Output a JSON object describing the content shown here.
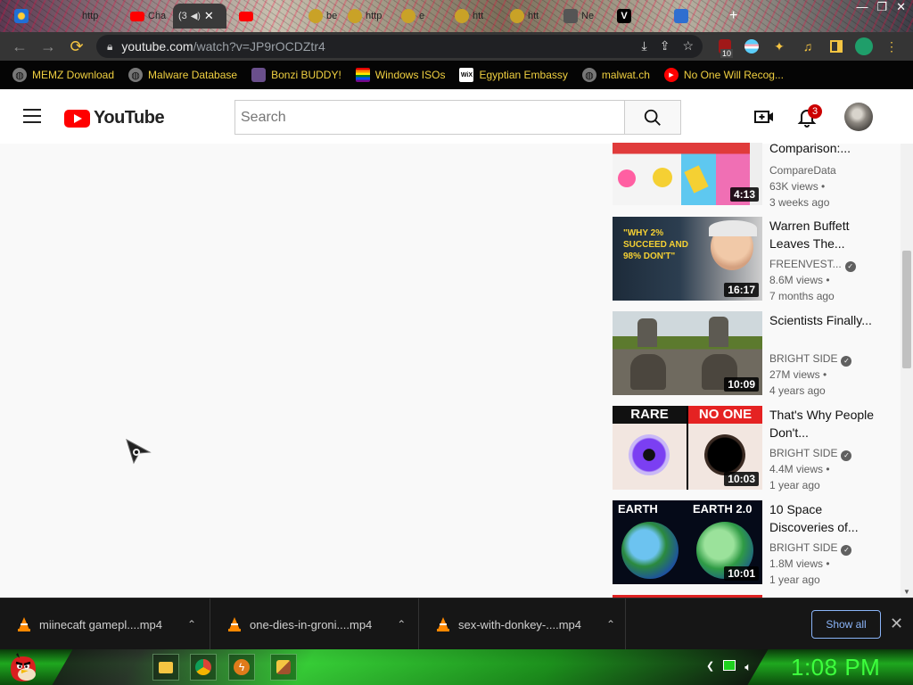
{
  "browser": {
    "tabs": [
      {
        "label": "http",
        "icon": "firefox-icon"
      },
      {
        "label": "Cha",
        "icon": "youtube-icon"
      },
      {
        "label": "(3",
        "icon": "youtube-icon",
        "active": true
      },
      {
        "label": "",
        "icon": "youtube-icon"
      },
      {
        "label": "be",
        "icon": "globe-icon"
      },
      {
        "label": "http",
        "icon": "globe-icon"
      },
      {
        "label": "e",
        "icon": "globe-icon"
      },
      {
        "label": "htt",
        "icon": "globe-icon"
      },
      {
        "label": "htt",
        "icon": "globe-icon"
      },
      {
        "label": "Ne",
        "icon": "shield-icon"
      },
      {
        "label": "",
        "icon": "v-icon"
      },
      {
        "label": "",
        "icon": "bug-icon"
      }
    ],
    "new_tab_label": "+",
    "url_domain": "youtube.com",
    "url_path": "/watch?v=JP9rOCDZtr4",
    "extension_badge": "10"
  },
  "bookmarks": [
    {
      "label": "MEMZ Download",
      "icon": "globe-icon"
    },
    {
      "label": "Malware Database",
      "icon": "globe-icon"
    },
    {
      "label": "Bonzi BUDDY!",
      "icon": "bonzi-icon"
    },
    {
      "label": "Windows ISOs",
      "icon": "windows-flag-icon"
    },
    {
      "label": "Egyptian Embassy",
      "icon": "wix-icon"
    },
    {
      "label": "malwat.ch",
      "icon": "globe-icon"
    },
    {
      "label": "No One Will Recog...",
      "icon": "youtube-icon"
    }
  ],
  "youtube": {
    "logo_text": "YouTube",
    "search_placeholder": "Search",
    "notification_count": "3"
  },
  "videos": [
    {
      "title": "Comparison:...",
      "channel": "CompareData",
      "verified": false,
      "views": "63K views",
      "age": "3 weeks ago",
      "duration": "4:13"
    },
    {
      "title": "Warren Buffett Leaves The...",
      "channel": "FREENVEST...",
      "verified": true,
      "views": "8.6M views",
      "age": "7 months ago",
      "duration": "16:17",
      "thumb_text": "\"WHY 2% SUCCEED AND 98% DON'T\""
    },
    {
      "title": "Scientists Finally...",
      "channel": "BRIGHT SIDE",
      "verified": true,
      "views": "27M views",
      "age": "4 years ago",
      "duration": "10:09"
    },
    {
      "title": "That's Why People Don't...",
      "channel": "BRIGHT SIDE",
      "verified": true,
      "views": "4.4M views",
      "age": "1 year ago",
      "duration": "10:03",
      "thumb_left": "RARE",
      "thumb_right": "NO ONE"
    },
    {
      "title": "10 Space Discoveries of...",
      "channel": "BRIGHT SIDE",
      "verified": true,
      "views": "1.8M views",
      "age": "1 year ago",
      "duration": "10:01",
      "thumb_left": "EARTH",
      "thumb_right": "EARTH 2.0"
    }
  ],
  "downloads": [
    {
      "filename": "miinecaft gamepl....mp4"
    },
    {
      "filename": "one-dies-in-groni....mp4"
    },
    {
      "filename": "sex-with-donkey-....mp4"
    }
  ],
  "download_bar": {
    "show_all_label": "Show all",
    "close_label": "✕"
  },
  "taskbar": {
    "clock": "1:08 PM"
  },
  "colors": {
    "accent_red": "#ff0000",
    "clock_green": "#3dff3d",
    "bookmark_text": "#f0d040"
  }
}
